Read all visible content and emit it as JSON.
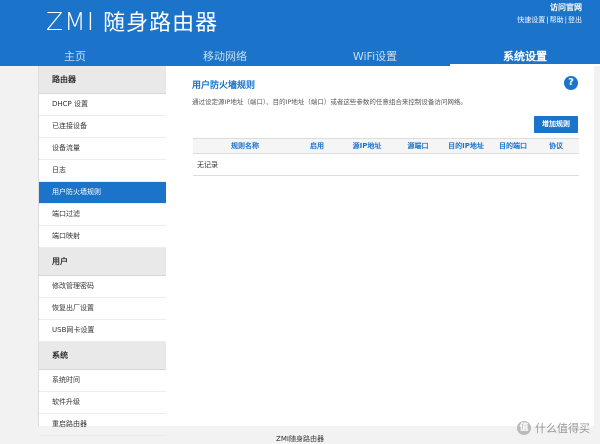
{
  "header": {
    "logo_mark": "ZMI",
    "logo_text": "随身路由器",
    "visit_site": "访问官网",
    "links": [
      "快速设置",
      "帮助",
      "登出"
    ],
    "link_sep": "|"
  },
  "nav": {
    "tabs": [
      {
        "label": "主页",
        "active": false
      },
      {
        "label": "移动网络",
        "active": false
      },
      {
        "label": "WiFi设置",
        "active": false
      },
      {
        "label": "系统设置",
        "active": true
      }
    ]
  },
  "sidebar": {
    "sections": [
      {
        "title": "路由器",
        "items": [
          {
            "label": "DHCP 设置"
          },
          {
            "label": "已连接设备"
          },
          {
            "label": "设备流量"
          },
          {
            "label": "日志"
          },
          {
            "label": "用户防火墙规则",
            "active": true
          },
          {
            "label": "端口过滤"
          },
          {
            "label": "端口映射"
          }
        ]
      },
      {
        "title": "用户",
        "items": [
          {
            "label": "修改管理密码"
          },
          {
            "label": "恢复出厂设置"
          },
          {
            "label": "USB网卡设置"
          }
        ]
      },
      {
        "title": "系统",
        "items": [
          {
            "label": "系统时间"
          },
          {
            "label": "软件升级"
          },
          {
            "label": "重启路由器"
          }
        ]
      }
    ]
  },
  "main": {
    "title": "用户防火墙规则",
    "help_icon": "?",
    "description": "通过设定源IP地址（端口）、目的IP地址（端口）或者这些参数的任意组合来控制设备访问网络。",
    "add_button": "增加规则",
    "table": {
      "columns": [
        "规则名称",
        "启用",
        "源IP地址",
        "源端口",
        "目的IP地址",
        "目的端口",
        "协议"
      ],
      "empty_text": "无记录"
    }
  },
  "footer": {
    "text": "ZMI随身路由器"
  },
  "watermark": {
    "icon": "值",
    "text": "什么值得买"
  },
  "colors": {
    "brand": "#1b74c9",
    "background": "#f2f2f2"
  }
}
